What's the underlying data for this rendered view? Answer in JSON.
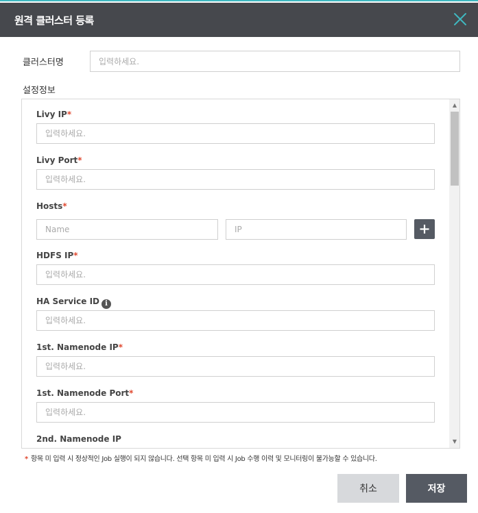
{
  "dialog": {
    "title": "원격 클러스터 등록",
    "close_icon": "close-icon"
  },
  "cluster_name": {
    "label": "클러스터명",
    "placeholder": "입력하세요."
  },
  "settings": {
    "label": "설정정보",
    "required_mark": "*",
    "livy_ip": {
      "label": "Livy IP",
      "placeholder": "입력하세요."
    },
    "livy_port": {
      "label": "Livy Port",
      "placeholder": "입력하세요."
    },
    "hosts": {
      "label": "Hosts",
      "name_placeholder": "Name",
      "ip_placeholder": "IP",
      "add_icon": "plus-icon"
    },
    "hdfs_ip": {
      "label": "HDFS IP",
      "placeholder": "입력하세요."
    },
    "ha_service_id": {
      "label": "HA Service ID",
      "placeholder": "입력하세요.",
      "info_icon": "info-icon",
      "info_glyph": "i"
    },
    "namenode1_ip": {
      "label": "1st. Namenode IP",
      "placeholder": "입력하세요."
    },
    "namenode1_port": {
      "label": "1st. Namenode Port",
      "placeholder": "입력하세요."
    },
    "namenode2_ip": {
      "label": "2nd. Namenode IP"
    }
  },
  "footnote": {
    "mark": "*",
    "text": "항목 미 입력 시 정상적인 Job 실행이 되지 않습니다. 선택 항목 미 입력 시 Job 수행 이력 및 모니터링이 불가능할 수 있습니다."
  },
  "buttons": {
    "cancel": "취소",
    "save": "저장"
  },
  "colors": {
    "header_bg": "#46484d",
    "accent": "#3fb8c0",
    "required": "#e0482f",
    "primary_button": "#555a63",
    "secondary_button": "#d7d9dc"
  }
}
